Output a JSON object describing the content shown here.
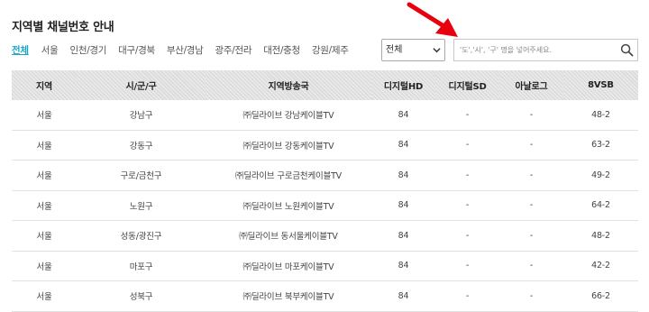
{
  "title": "지역별 채널번호 안내",
  "regions": [
    {
      "label": "전체",
      "active": true
    },
    {
      "label": "서울",
      "active": false
    },
    {
      "label": "인천/경기",
      "active": false
    },
    {
      "label": "대구/경북",
      "active": false
    },
    {
      "label": "부산/경남",
      "active": false
    },
    {
      "label": "광주/전라",
      "active": false
    },
    {
      "label": "대전/충청",
      "active": false
    },
    {
      "label": "강원/제주",
      "active": false
    }
  ],
  "filter": {
    "selected": "전체"
  },
  "search": {
    "placeholder": "'도','시', '구' 명을 넣어주세요.",
    "value": ""
  },
  "accent_color": "#1aa7c4",
  "annotation_arrow_color": "#e8000e",
  "table": {
    "headers": [
      "지역",
      "시/군/구",
      "지역방송국",
      "디지털HD",
      "디지털SD",
      "아날로그",
      "8VSB"
    ],
    "rows": [
      [
        "서울",
        "강남구",
        "㈜딜라이브 강남케이블TV",
        "84",
        "-",
        "-",
        "48-2"
      ],
      [
        "서울",
        "강동구",
        "㈜딜라이브 강동케이블TV",
        "84",
        "-",
        "-",
        "63-2"
      ],
      [
        "서울",
        "구로/금천구",
        "㈜딜라이브 구로금천케이블TV",
        "84",
        "-",
        "-",
        "49-2"
      ],
      [
        "서울",
        "노원구",
        "㈜딜라이브 노원케이블TV",
        "84",
        "-",
        "-",
        "64-2"
      ],
      [
        "서울",
        "성동/광진구",
        "㈜딜라이브 동서울케이블TV",
        "84",
        "-",
        "-",
        "48-2"
      ],
      [
        "서울",
        "마포구",
        "㈜딜라이브 마포케이블TV",
        "84",
        "-",
        "-",
        "42-2"
      ],
      [
        "서울",
        "성북구",
        "㈜딜라이브 북부케이블TV",
        "84",
        "-",
        "-",
        "66-2"
      ]
    ]
  }
}
